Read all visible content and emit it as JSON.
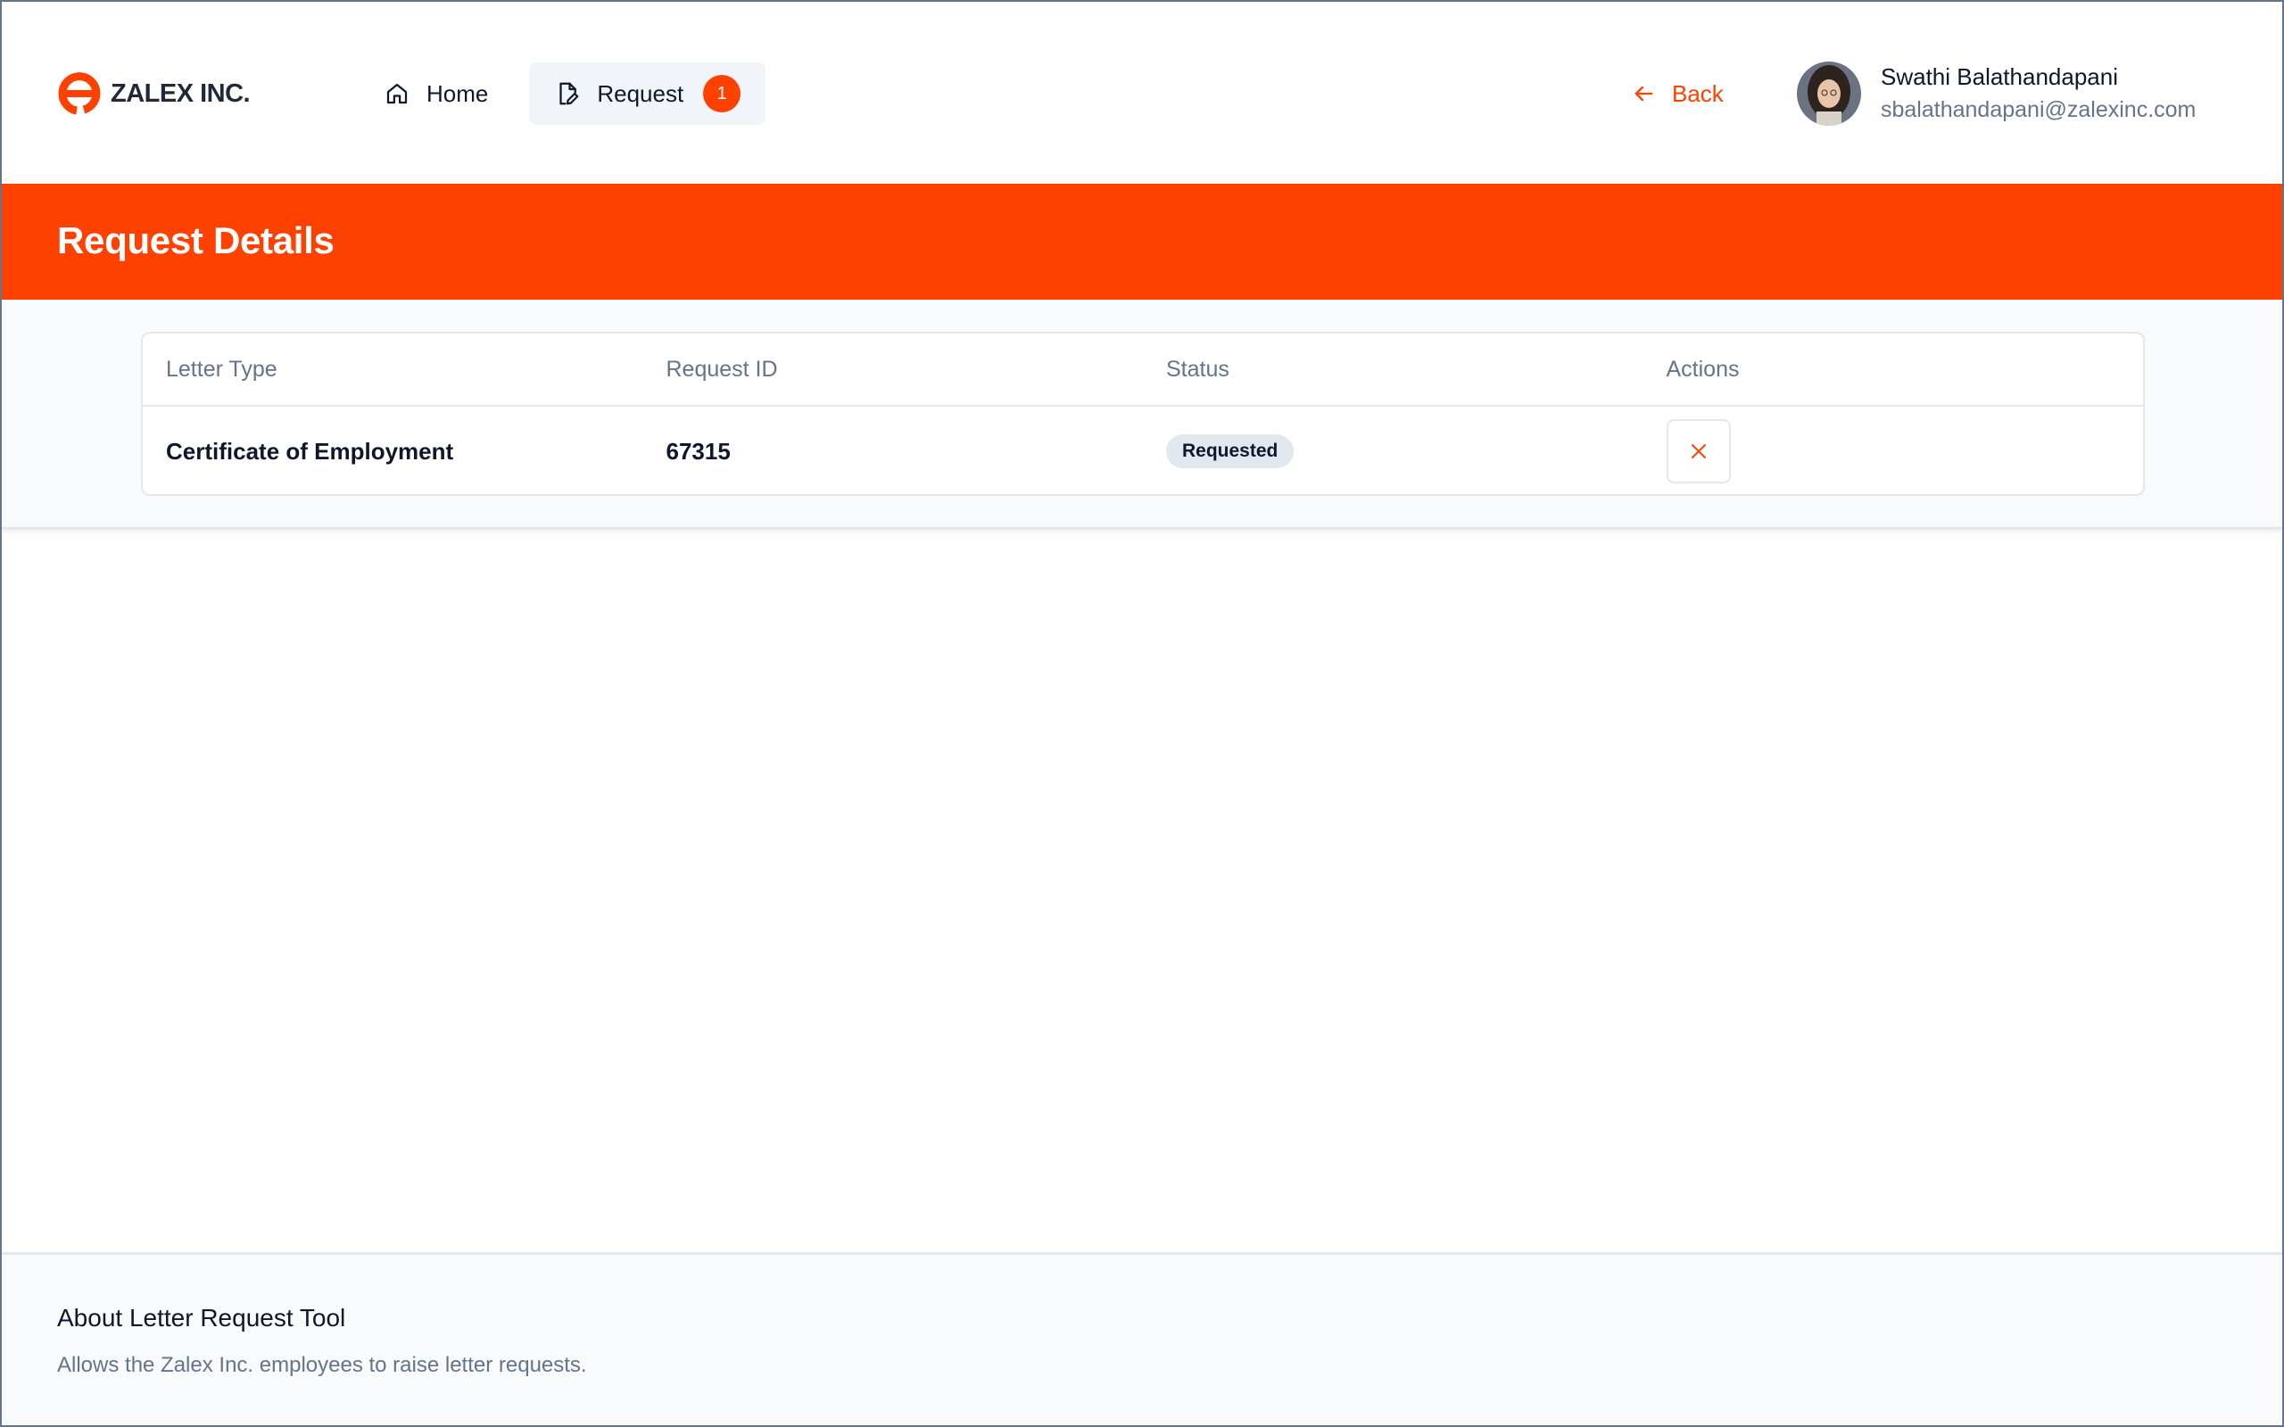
{
  "brand": {
    "name": "ZALEX INC.",
    "accent": "#ff4100"
  },
  "nav": {
    "home_label": "Home",
    "request_label": "Request",
    "request_badge": "1"
  },
  "header": {
    "back_label": "Back",
    "user": {
      "name": "Swathi Balathandapani",
      "email": "sbalathandapani@zalexinc.com"
    }
  },
  "banner": {
    "title": "Request Details"
  },
  "table": {
    "headers": [
      "Letter Type",
      "Request ID",
      "Status",
      "Actions"
    ],
    "rows": [
      {
        "letter_type": "Certificate of Employment",
        "request_id": "67315",
        "status": "Requested"
      }
    ]
  },
  "footer": {
    "title": "About Letter Request Tool",
    "description": "Allows the Zalex Inc. employees to raise letter requests."
  },
  "icons": {
    "home": "home-icon",
    "request": "document-edit-icon",
    "back": "arrow-left-icon",
    "action": "close-icon"
  }
}
